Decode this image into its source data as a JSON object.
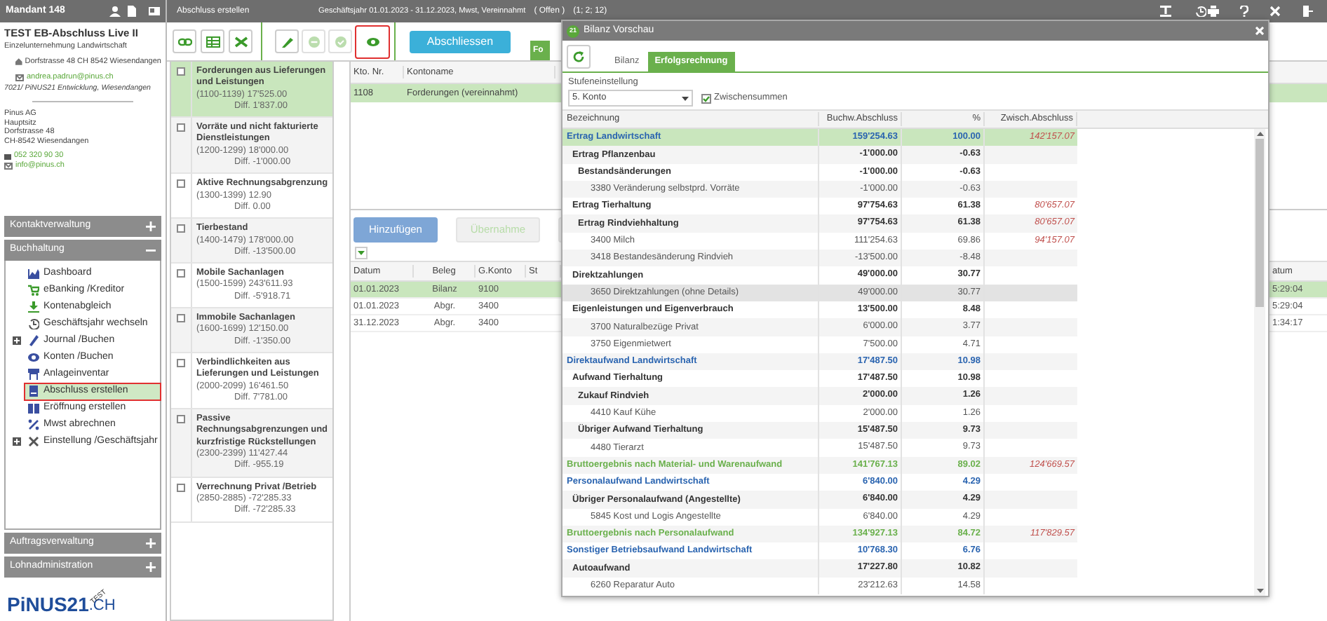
{
  "sidebar": {
    "header": "Mandant 148",
    "company": {
      "name": "TEST EB-Abschluss Live II",
      "type": "Einzelunternehmung Landwirtschaft",
      "address": "Dorfstrasse 48 CH 8542 Wiesendangen",
      "email": "andrea.padrun@pinus.ch",
      "note": "7021/ PiNUS21 Entwicklung, Wiesendangen"
    },
    "provider": {
      "lines": [
        "Pinus AG",
        "Hauptsitz",
        "Dorfstrasse 48",
        "CH-8542 Wiesendangen"
      ],
      "phone": "052 320 90 30",
      "email": "info@pinus.ch"
    },
    "sections": [
      {
        "title": "Kontaktverwaltung",
        "expanded": false
      },
      {
        "title": "Buchhaltung",
        "expanded": true,
        "items": [
          {
            "label": "Dashboard",
            "expandable": false,
            "selected": false
          },
          {
            "label": "eBanking /Kreditor",
            "expandable": false,
            "selected": false
          },
          {
            "label": "Kontenabgleich",
            "expandable": false,
            "selected": false
          },
          {
            "label": "Geschäftsjahr wechseln",
            "expandable": false,
            "selected": false
          },
          {
            "label": "Journal /Buchen",
            "expandable": true,
            "selected": false
          },
          {
            "label": "Konten /Buchen",
            "expandable": false,
            "selected": false
          },
          {
            "label": "Anlageinventar",
            "expandable": false,
            "selected": false
          },
          {
            "label": "Abschluss erstellen",
            "expandable": false,
            "selected": true
          },
          {
            "label": "Eröffnung erstellen",
            "expandable": false,
            "selected": false
          },
          {
            "label": "Mwst abrechnen",
            "expandable": false,
            "selected": false
          },
          {
            "label": "Einstellung /Geschäftsjahr",
            "expandable": true,
            "selected": false
          }
        ]
      },
      {
        "title": "Auftragsverwaltung",
        "expanded": false
      },
      {
        "title": "Lohnadministration",
        "expanded": false
      }
    ],
    "logo": {
      "text": "PiNUS21",
      "suffix": ".CH",
      "stamp": "TEST"
    }
  },
  "header": {
    "title": "Abschluss erstellen",
    "fiscal_year": "Geschäftsjahr 01.01.2023 - 31.12.2023, Mwst, Vereinnahmt",
    "status": "( Offen )",
    "counts": "(1; 2; 12)"
  },
  "toolbar": {
    "buttons": [
      {
        "disabled": false,
        "highlighted": false
      },
      {
        "disabled": false,
        "highlighted": false
      },
      {
        "disabled": false,
        "highlighted": false
      },
      {
        "disabled": false,
        "highlighted": false
      },
      {
        "disabled": true,
        "highlighted": false
      },
      {
        "disabled": true,
        "highlighted": false
      },
      {
        "disabled": false,
        "highlighted": true
      }
    ],
    "primary_button": "Abschliessen",
    "tab": "Fo"
  },
  "groups": [
    {
      "title": "Forderungen aus Lieferungen und Leistungen",
      "range": "(1100-1139) 17'525.00",
      "diff": "Diff. 1'837.00",
      "checked": false,
      "selected": true
    },
    {
      "title": "Vorräte und nicht fakturierte Dienstleistungen",
      "range": "(1200-1299) 18'000.00",
      "diff": "Diff. -1'000.00",
      "checked": false,
      "selected": false
    },
    {
      "title": "Aktive Rechnungsabgrenzung",
      "range": "(1300-1399) 12.90",
      "diff": "Diff. 0.00",
      "checked": false,
      "selected": false
    },
    {
      "title": "Tierbestand",
      "range": "(1400-1479) 178'000.00",
      "diff": "Diff. -13'500.00",
      "checked": false,
      "selected": false
    },
    {
      "title": "Mobile Sachanlagen",
      "range": "(1500-1599) 243'611.93",
      "diff": "Diff. -5'918.71",
      "checked": false,
      "selected": false
    },
    {
      "title": "Immobile Sachanlagen",
      "range": "(1600-1699) 12'150.00",
      "diff": "Diff. -1'350.00",
      "checked": false,
      "selected": false
    },
    {
      "title": "Verbindlichkeiten aus Lieferungen und Leistungen",
      "range": "(2000-2099) 16'461.50",
      "diff": "Diff. 7'781.00",
      "checked": false,
      "selected": false
    },
    {
      "title": "Passive Rechnungsabgrenzungen und kurzfristige Rückstellungen",
      "range": "(2300-2399) 11'427.44",
      "diff": "Diff. -955.19",
      "checked": false,
      "selected": false
    },
    {
      "title": "Verrechnung Privat /Betrieb",
      "range": "(2850-2885) -72'285.33",
      "diff": "Diff. -72'285.33",
      "checked": false,
      "selected": false
    }
  ],
  "accounts_table": {
    "columns": [
      "Kto. Nr.",
      "Kontoname"
    ],
    "rows": [
      {
        "cells": [
          "1108",
          "Forderungen (vereinnahmt)"
        ],
        "selected": true
      }
    ]
  },
  "booking_buttons": [
    {
      "label": "Hinzufügen",
      "disabled": false
    },
    {
      "label": "Übernahme",
      "disabled": true
    },
    {
      "disabled": true
    }
  ],
  "bookings_table": {
    "columns": [
      "Datum",
      "Beleg",
      "G.Konto",
      "St"
    ],
    "edge_column": "atum",
    "rows": [
      {
        "cells": [
          "01.01.2023",
          "Bilanz",
          "9100"
        ],
        "edge_cell": "5:29:04",
        "selected": true
      },
      {
        "cells": [
          "01.01.2023",
          "Abgr.",
          "3400"
        ],
        "edge_cell": "5:29:04",
        "selected": false
      },
      {
        "cells": [
          "31.12.2023",
          "Abgr.",
          "3400"
        ],
        "edge_cell": "1:34:17",
        "selected": false
      }
    ]
  },
  "dialog": {
    "badge": "21",
    "title": "Bilanz Vorschau",
    "tabs": [
      {
        "label": "Bilanz",
        "selected": false
      },
      {
        "label": "Erfolgsrechnung",
        "selected": true
      }
    ],
    "level_label": "Stufeneinstellung",
    "level_value": "5. Konto",
    "subtotals": {
      "label": "Zwischensummen",
      "checked": true
    },
    "columns": [
      "Bezeichnung",
      "Buchw.Abschluss",
      "%",
      "Zwisch.Abschluss"
    ],
    "rows": [
      {
        "kind": "group",
        "label": "Ertrag Landwirtschaft",
        "amount": "159'254.63",
        "percent": "100.00",
        "subtotal": "142'157.07",
        "selected": true,
        "hovered": false,
        "children": [
          {
            "kind": "sum",
            "label": "Ertrag Pflanzenbau",
            "amount": "-1'000.00",
            "percent": "-0.63",
            "selected": false,
            "hovered": false,
            "children": [
              {
                "kind": "sum",
                "label": "Bestandsänderungen",
                "amount": "-1'000.00",
                "percent": "-0.63",
                "selected": false,
                "hovered": false,
                "children": [
                  {
                    "kind": "account",
                    "label": "3380 Veränderung selbstprd. Vorräte",
                    "amount": "-1'000.00",
                    "percent": "-0.63",
                    "selected": false,
                    "hovered": false
                  }
                ]
              }
            ]
          },
          {
            "kind": "sum",
            "label": "Ertrag Tierhaltung",
            "amount": "97'754.63",
            "percent": "61.38",
            "subtotal": "80'657.07",
            "selected": false,
            "hovered": false,
            "children": [
              {
                "kind": "sum",
                "label": "Ertrag Rindviehhaltung",
                "amount": "97'754.63",
                "percent": "61.38",
                "subtotal": "80'657.07",
                "selected": false,
                "hovered": false,
                "children": [
                  {
                    "kind": "account",
                    "label": "3400 Milch",
                    "amount": "111'254.63",
                    "percent": "69.86",
                    "subtotal": "94'157.07",
                    "selected": false,
                    "hovered": false
                  },
                  {
                    "kind": "account",
                    "label": "3418 Bestandesänderung Rindvieh",
                    "amount": "-13'500.00",
                    "percent": "-8.48",
                    "selected": false,
                    "hovered": false
                  }
                ]
              }
            ]
          },
          {
            "kind": "sum",
            "label": "Direktzahlungen",
            "amount": "49'000.00",
            "percent": "30.77",
            "selected": false,
            "hovered": false,
            "children": [
              {
                "kind": "account",
                "label": "3650 Direktzahlungen (ohne Details)",
                "amount": "49'000.00",
                "percent": "30.77",
                "selected": false,
                "hovered": true
              }
            ]
          },
          {
            "kind": "sum",
            "label": "Eigenleistungen und Eigenverbrauch",
            "amount": "13'500.00",
            "percent": "8.48",
            "selected": false,
            "hovered": false,
            "children": [
              {
                "kind": "account",
                "label": "3700 Naturalbezüge Privat",
                "amount": "6'000.00",
                "percent": "3.77",
                "selected": false,
                "hovered": false
              },
              {
                "kind": "account",
                "label": "3750 Eigenmietwert",
                "amount": "7'500.00",
                "percent": "4.71",
                "selected": false,
                "hovered": false
              }
            ]
          }
        ]
      },
      {
        "kind": "group",
        "label": "Direktaufwand Landwirtschaft",
        "amount": "17'487.50",
        "percent": "10.98",
        "selected": false,
        "hovered": false,
        "children": [
          {
            "kind": "sum",
            "label": "Aufwand Tierhaltung",
            "amount": "17'487.50",
            "percent": "10.98",
            "selected": false,
            "hovered": false,
            "children": [
              {
                "kind": "sum",
                "label": "Zukauf Rindvieh",
                "amount": "2'000.00",
                "percent": "1.26",
                "selected": false,
                "hovered": false,
                "children": [
                  {
                    "kind": "account",
                    "label": "4410 Kauf Kühe",
                    "amount": "2'000.00",
                    "percent": "1.26",
                    "selected": false,
                    "hovered": false
                  }
                ]
              },
              {
                "kind": "sum",
                "label": "Übriger Aufwand Tierhaltung",
                "amount": "15'487.50",
                "percent": "9.73",
                "selected": false,
                "hovered": false,
                "children": [
                  {
                    "kind": "account",
                    "label": "4480 Tierarzt",
                    "amount": "15'487.50",
                    "percent": "9.73",
                    "selected": false,
                    "hovered": false
                  }
                ]
              }
            ]
          }
        ]
      },
      {
        "kind": "result",
        "label": "Bruttoergebnis nach Material- und Warenaufwand",
        "amount": "141'767.13",
        "percent": "89.02",
        "subtotal": "124'669.57",
        "selected": false,
        "hovered": false
      },
      {
        "kind": "group",
        "label": "Personalaufwand Landwirtschaft",
        "amount": "6'840.00",
        "percent": "4.29",
        "selected": false,
        "hovered": false,
        "children": [
          {
            "kind": "sum",
            "label": "Übriger Personalaufwand (Angestellte)",
            "amount": "6'840.00",
            "percent": "4.29",
            "selected": false,
            "hovered": false,
            "children": [
              {
                "kind": "account",
                "label": "5845 Kost und Logis Angestellte",
                "amount": "6'840.00",
                "percent": "4.29",
                "selected": false,
                "hovered": false
              }
            ]
          }
        ]
      },
      {
        "kind": "result",
        "label": "Bruttoergebnis nach Personalaufwand",
        "amount": "134'927.13",
        "percent": "84.72",
        "subtotal": "117'829.57",
        "selected": false,
        "hovered": false
      },
      {
        "kind": "group",
        "label": "Sonstiger Betriebsaufwand Landwirtschaft",
        "amount": "10'768.30",
        "percent": "6.76",
        "selected": false,
        "hovered": false,
        "children": [
          {
            "kind": "sum",
            "label": "Autoaufwand",
            "amount": "17'227.80",
            "percent": "10.82",
            "selected": false,
            "hovered": false,
            "children": [
              {
                "kind": "account",
                "label": "6260 Reparatur Auto",
                "amount": "23'212.63",
                "percent": "14.58",
                "selected": false,
                "hovered": false
              }
            ]
          }
        ]
      }
    ]
  }
}
